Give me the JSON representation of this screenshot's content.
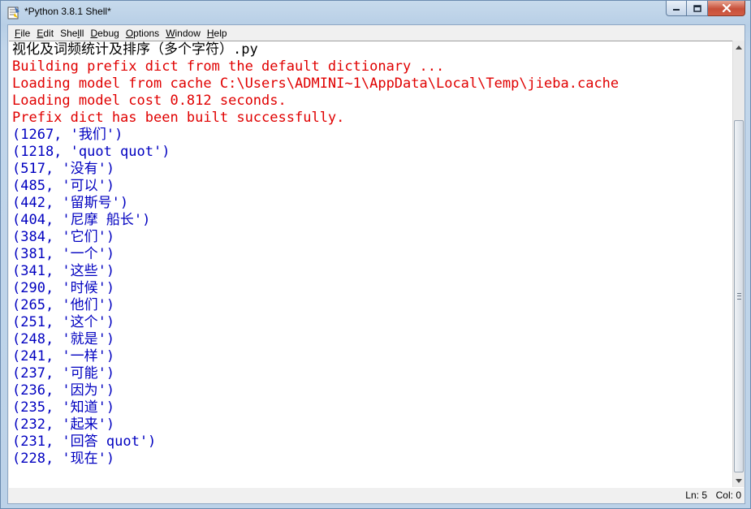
{
  "window": {
    "title": "*Python 3.8.1 Shell*",
    "close_color": "#c7503a"
  },
  "menu": [
    {
      "mnemonic": "F",
      "rest": "ile"
    },
    {
      "mnemonic": "E",
      "rest": "dit"
    },
    {
      "mnemonic": "",
      "pre": "She",
      "post": "ll",
      "mnemonic_mid": "l"
    },
    {
      "mnemonic": "D",
      "rest": "ebug"
    },
    {
      "mnemonic": "O",
      "rest": "ptions"
    },
    {
      "mnemonic": "W",
      "rest": "indow"
    },
    {
      "mnemonic": "H",
      "rest": "elp"
    }
  ],
  "shell": {
    "lines": [
      {
        "kind": "plain",
        "text": "视化及词频统计及排序（多个字符）.py"
      },
      {
        "kind": "stderr",
        "text": "Building prefix dict from the default dictionary ..."
      },
      {
        "kind": "stderr",
        "text": "Loading model from cache C:\\Users\\ADMINI~1\\AppData\\Local\\Temp\\jieba.cache"
      },
      {
        "kind": "stderr",
        "text": "Loading model cost 0.812 seconds."
      },
      {
        "kind": "stderr",
        "text": "Prefix dict has been built successfully."
      },
      {
        "kind": "stdout",
        "text": "(1267, '我们')"
      },
      {
        "kind": "stdout",
        "text": "(1218, 'quot quot')"
      },
      {
        "kind": "stdout",
        "text": "(517, '没有')"
      },
      {
        "kind": "stdout",
        "text": "(485, '可以')"
      },
      {
        "kind": "stdout",
        "text": "(442, '留斯号')"
      },
      {
        "kind": "stdout",
        "text": "(404, '尼摩 船长')"
      },
      {
        "kind": "stdout",
        "text": "(384, '它们')"
      },
      {
        "kind": "stdout",
        "text": "(381, '一个')"
      },
      {
        "kind": "stdout",
        "text": "(341, '这些')"
      },
      {
        "kind": "stdout",
        "text": "(290, '时候')"
      },
      {
        "kind": "stdout",
        "text": "(265, '他们')"
      },
      {
        "kind": "stdout",
        "text": "(251, '这个')"
      },
      {
        "kind": "stdout",
        "text": "(248, '就是')"
      },
      {
        "kind": "stdout",
        "text": "(241, '一样')"
      },
      {
        "kind": "stdout",
        "text": "(237, '可能')"
      },
      {
        "kind": "stdout",
        "text": "(236, '因为')"
      },
      {
        "kind": "stdout",
        "text": "(235, '知道')"
      },
      {
        "kind": "stdout",
        "text": "(232, '起来')"
      },
      {
        "kind": "stdout",
        "text": "(231, '回答 quot')"
      },
      {
        "kind": "stdout",
        "text": "(228, '现在')"
      }
    ],
    "colors": {
      "stdout": "#0000c0",
      "stderr": "#e00000"
    }
  },
  "status": {
    "ln": "Ln: 5",
    "col": "Col: 0"
  }
}
